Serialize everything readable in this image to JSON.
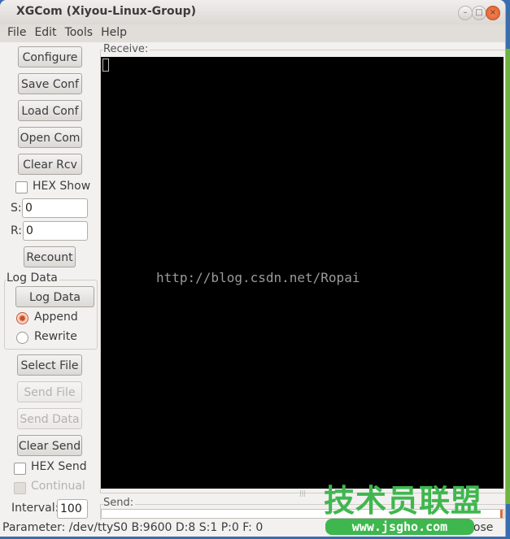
{
  "window": {
    "title": "XGCom (Xiyou-Linux-Group)",
    "controls": {
      "minimize": "–",
      "maximize": "□",
      "close": "×"
    }
  },
  "menu": [
    "File",
    "Edit",
    "Tools",
    "Help"
  ],
  "left_panel": {
    "buttons": {
      "configure": "Configure",
      "save_conf": "Save Conf",
      "load_conf": "Load Conf",
      "open_com": "Open Com",
      "clear_rcv": "Clear Rcv",
      "recount": "Recount",
      "log_data": "Log Data",
      "select_file": "Select File",
      "send_file": "Send File",
      "send_data": "Send Data",
      "clear_send": "Clear Send"
    },
    "hex_show": {
      "label": "HEX Show",
      "checked": false
    },
    "s_label": "S:",
    "s_value": "0",
    "r_label": "R:",
    "r_value": "0",
    "log_group": {
      "title": "Log Data",
      "append": {
        "label": "Append",
        "selected": true
      },
      "rewrite": {
        "label": "Rewrite",
        "selected": false
      }
    },
    "hex_send": {
      "label": "HEX Send",
      "checked": false
    },
    "continual": {
      "label": "Continual",
      "checked": false,
      "disabled": true
    },
    "interval_label": "Interval:",
    "interval_value": "100"
  },
  "receive": {
    "label": "Receive:",
    "watermark": "http://blog.csdn.net/Ropai"
  },
  "send": {
    "label": "Send:",
    "value": ""
  },
  "status": {
    "parameter": "Parameter: /dev/ttyS0 B:9600 D:8 S:1 P:0 F: 0",
    "right": "lose"
  },
  "overlay_watermark": {
    "chinese": "技术员联盟",
    "url": "www.jsgho.com"
  },
  "colors": {
    "accent": "#df5a2a",
    "watermark_green": "#3fb74f",
    "terminal_bg": "#000000"
  }
}
